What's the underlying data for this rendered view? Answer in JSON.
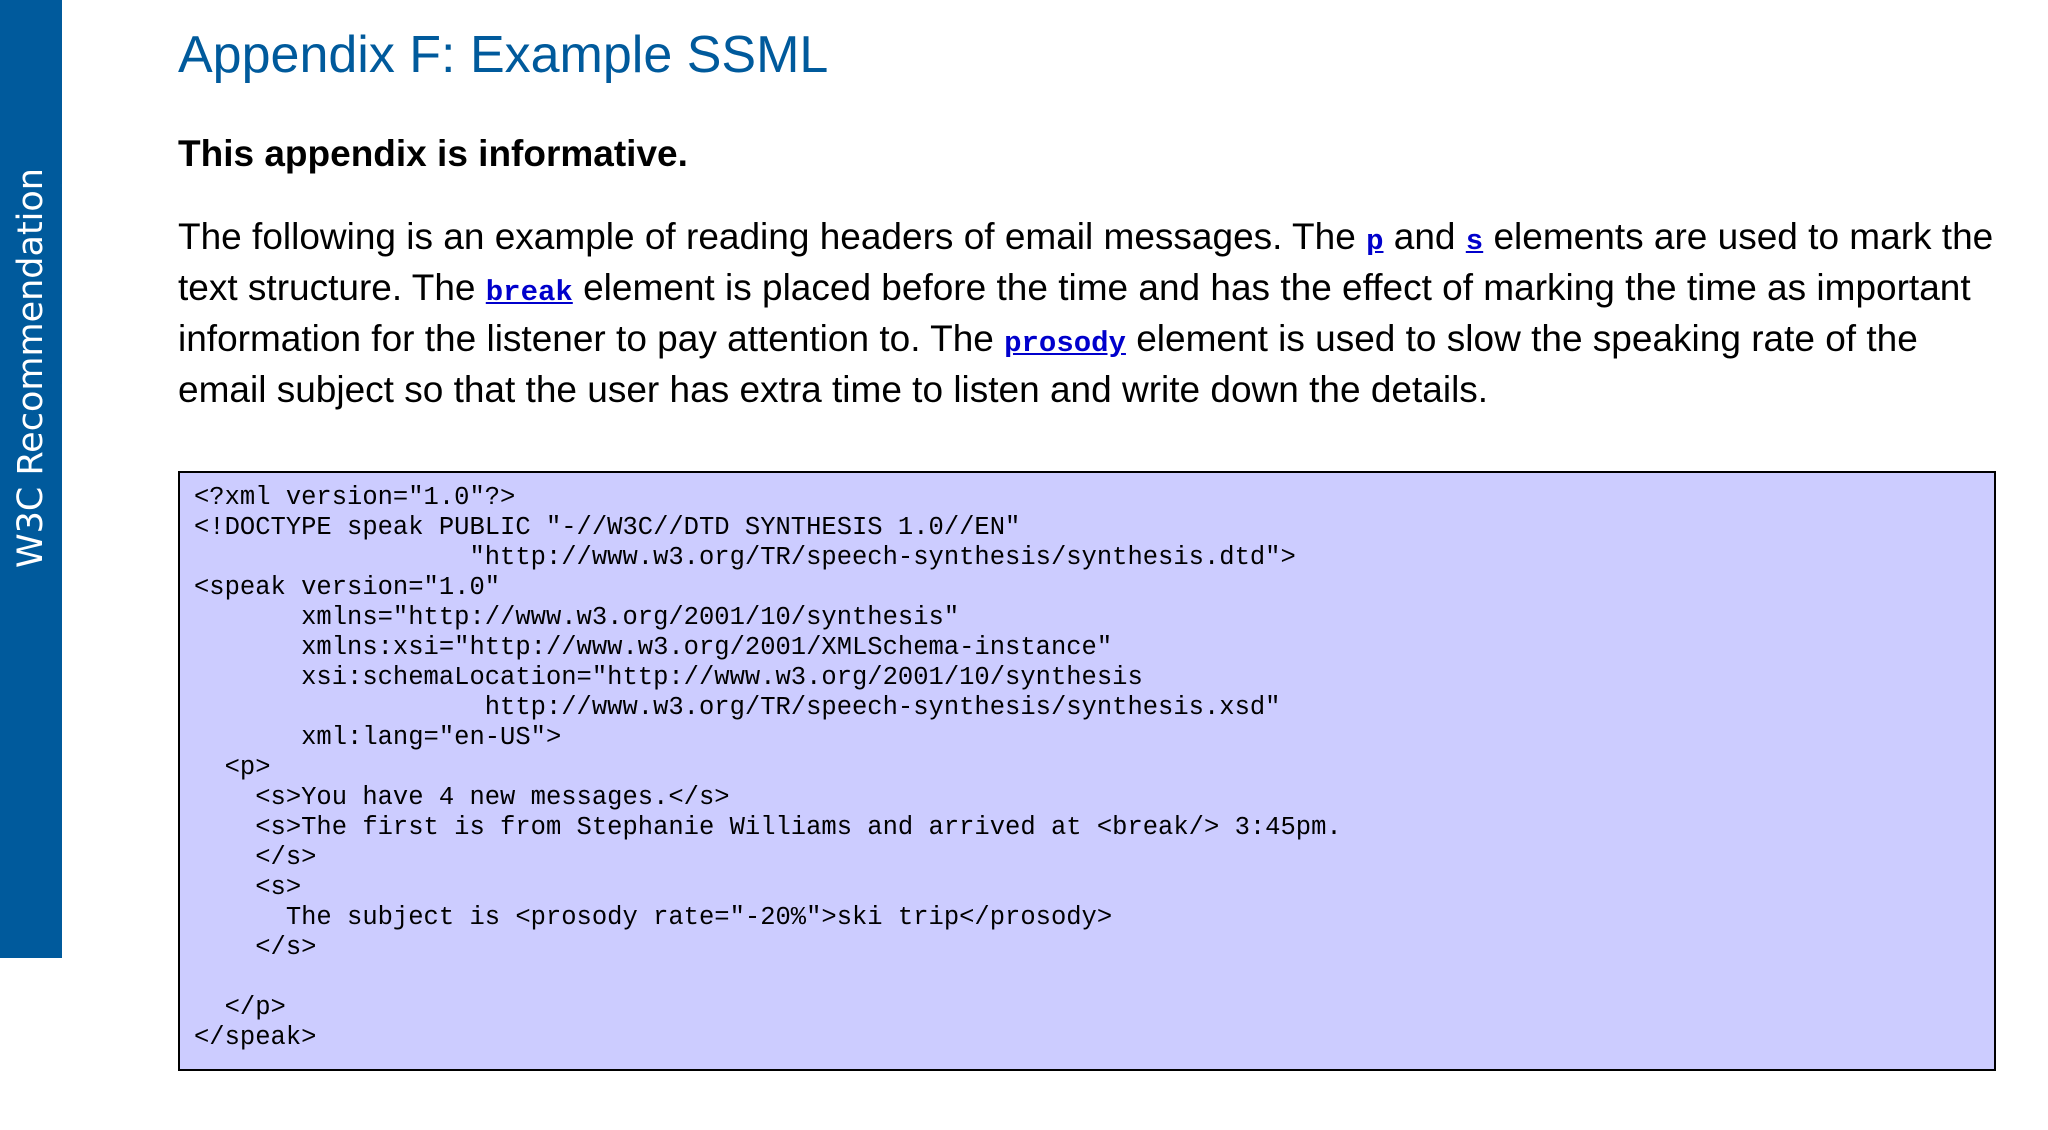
{
  "sidebar": {
    "label": "W3C Recommendation",
    "color": "#005a9c"
  },
  "section": {
    "title": "Appendix F: Example SSML",
    "informative_note": "This appendix is informative.",
    "paragraph": {
      "t1": "The following is an example of reading headers of email messages. The ",
      "link_p": "p",
      "t2": " and ",
      "link_s": "s",
      "t3": " elements are used to mark the text structure. The ",
      "link_break": "break",
      "t4": " element is placed before the time and has the effect of marking the time as important information for the listener to pay attention to. The ",
      "link_prosody": "prosody",
      "t5": " element is used to slow the speaking rate of the email subject so that the user has extra time to listen and write down the details."
    },
    "code": "<?xml version=\"1.0\"?>\n<!DOCTYPE speak PUBLIC \"-//W3C//DTD SYNTHESIS 1.0//EN\"\n                  \"http://www.w3.org/TR/speech-synthesis/synthesis.dtd\">\n<speak version=\"1.0\"\n       xmlns=\"http://www.w3.org/2001/10/synthesis\"\n       xmlns:xsi=\"http://www.w3.org/2001/XMLSchema-instance\"\n       xsi:schemaLocation=\"http://www.w3.org/2001/10/synthesis\n                   http://www.w3.org/TR/speech-synthesis/synthesis.xsd\"\n       xml:lang=\"en-US\">\n  <p>\n    <s>You have 4 new messages.</s>\n    <s>The first is from Stephanie Williams and arrived at <break/> 3:45pm.\n    </s>\n    <s>\n      The subject is <prosody rate=\"-20%\">ski trip</prosody>\n    </s>\n\n  </p>\n</speak>"
  },
  "colors": {
    "title": "#005a9c",
    "link": "#0000cc",
    "code_background": "#ccccff"
  }
}
